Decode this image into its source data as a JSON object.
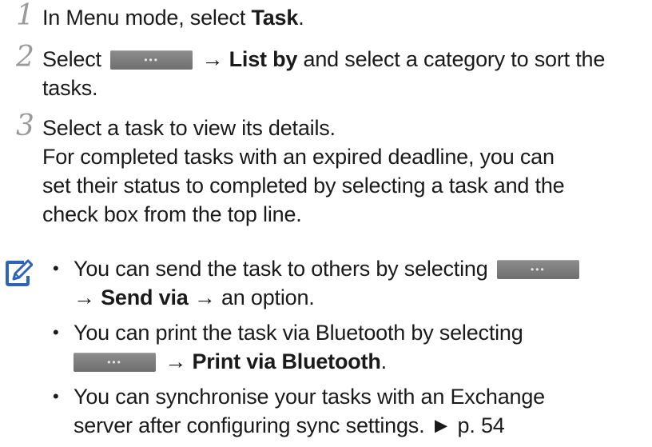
{
  "steps": [
    {
      "number": "1",
      "text_pre": "In Menu mode, select ",
      "text_bold": "Task",
      "text_post": "."
    },
    {
      "number": "2",
      "text_pre": "Select ",
      "arrow": "→",
      "text_bold": "List by",
      "text_post": " and select a category to sort the",
      "line2": "tasks."
    },
    {
      "number": "3",
      "line1": "Select a task to view its details.",
      "line2": "For completed tasks with an expired deadline, you can",
      "line3": "set their status to completed by selecting a task and the",
      "line4": "check box from the top line."
    }
  ],
  "menu_button": {
    "glyph": "•••",
    "icon": "more-options-icon"
  },
  "note": {
    "icon": "note-pencil-icon",
    "bullets": [
      {
        "text_pre": "You can send the task to others by selecting",
        "arrow": "→",
        "bold": "Send via",
        "text_post": " → an option."
      },
      {
        "text_pre": "You can print the task via Bluetooth by selecting",
        "arrow": "→",
        "bold": "Print via Bluetooth",
        "text_post": "."
      },
      {
        "line1": "You can synchronise your tasks with an Exchange",
        "line2": "server after configuring sync settings. ► p. 54"
      }
    ]
  }
}
